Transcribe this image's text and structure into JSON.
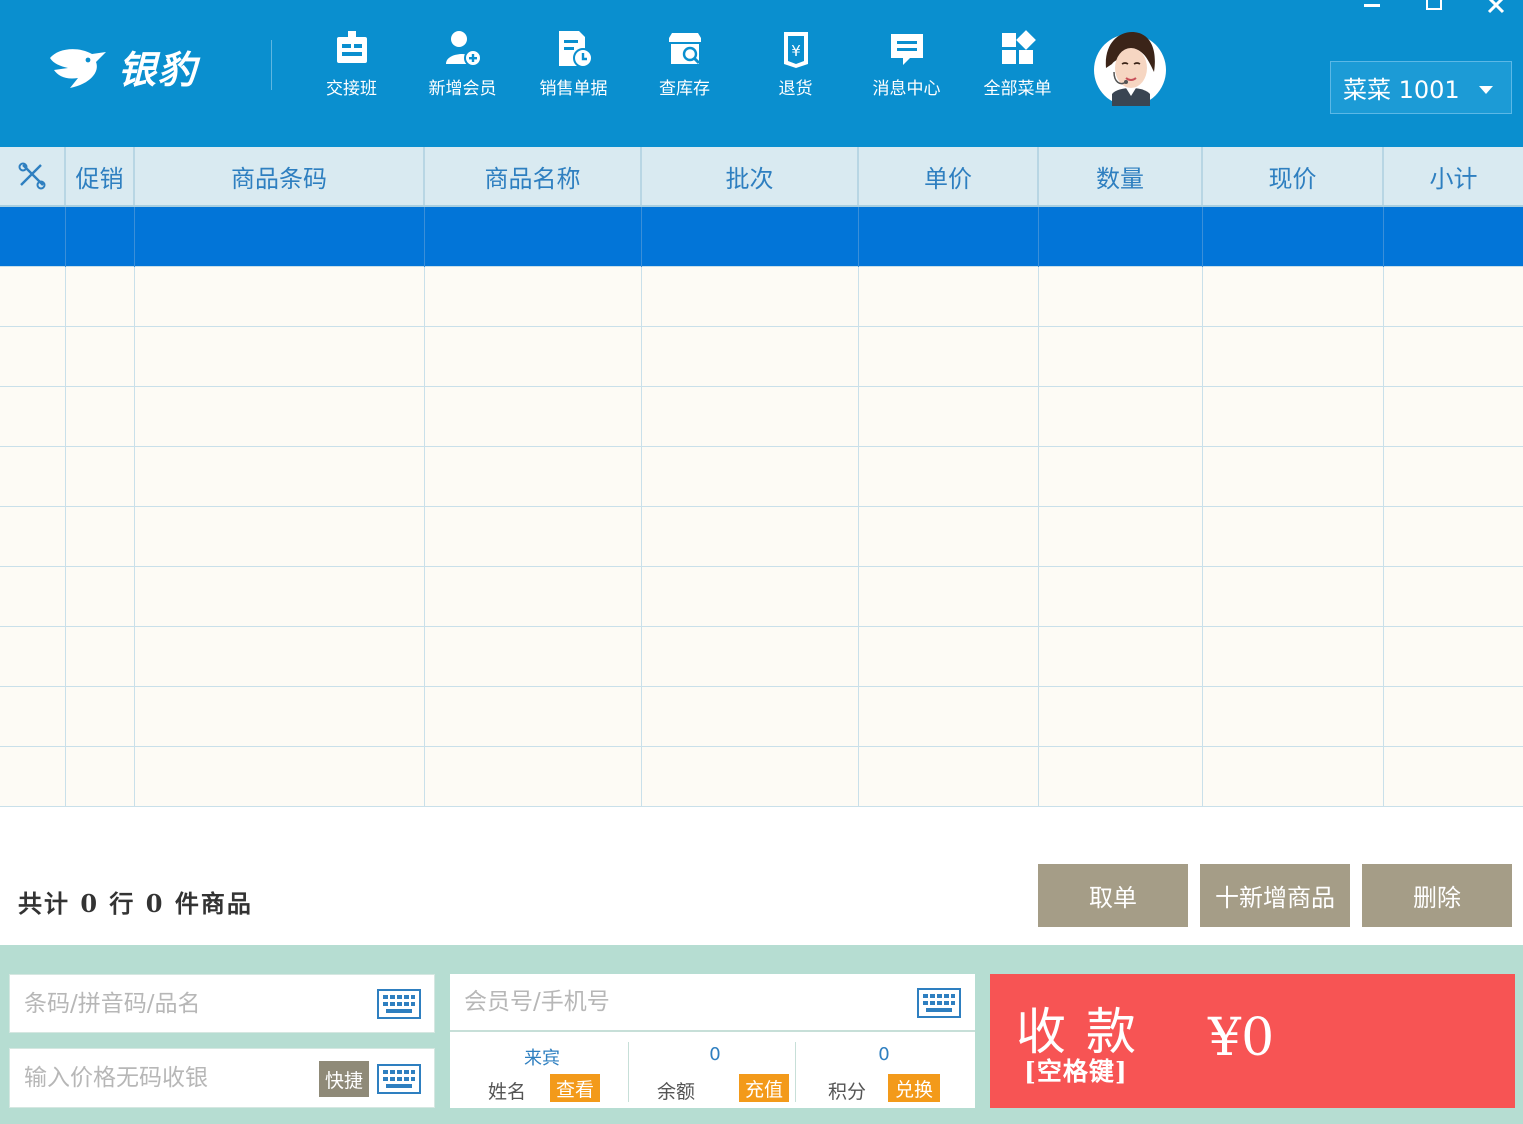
{
  "brand": {
    "logo_text": "银豹"
  },
  "toolbar": [
    {
      "label": "交接班",
      "icon": "shift-handover-icon"
    },
    {
      "label": "新增会员",
      "icon": "add-member-icon"
    },
    {
      "label": "销售单据",
      "icon": "sales-receipts-icon"
    },
    {
      "label": "查库存",
      "icon": "inventory-check-icon"
    },
    {
      "label": "退货",
      "icon": "return-goods-icon"
    },
    {
      "label": "消息中心",
      "icon": "message-center-icon"
    },
    {
      "label": "全部菜单",
      "icon": "all-menu-icon"
    }
  ],
  "user": {
    "name": "菜菜 1001"
  },
  "table": {
    "columns": [
      "",
      "促销",
      "商品条码",
      "商品名称",
      "批次",
      "单价",
      "数量",
      "现价",
      "小计"
    ],
    "rows": 10,
    "selected_row": 0
  },
  "summary": {
    "text": "共计 0 行 0 件商品"
  },
  "actions": {
    "cancel_order": "取单",
    "add_product": "十新增商品",
    "delete": "删除"
  },
  "barcode_input": {
    "placeholder": "条码/拼音码/品名"
  },
  "price_input": {
    "placeholder": "输入价格无码收银",
    "quick_label": "快捷"
  },
  "member": {
    "placeholder": "会员号/手机号",
    "name_value": "来宾",
    "name_label": "姓名",
    "view_label": "查看",
    "balance_value": "0",
    "balance_label": "余额",
    "recharge_label": "充值",
    "points_value": "0",
    "points_label": "积分",
    "redeem_label": "兑换"
  },
  "payment": {
    "title": "收款",
    "hint": "[空格键]",
    "amount": "¥0"
  },
  "colors": {
    "header": "#0a8fcf",
    "selected_row": "#0275d8",
    "pay_button": "#f75454",
    "action_button": "#a59d87",
    "tag_orange": "#f39a1a",
    "bottom_panel": "#b6ddd2"
  }
}
